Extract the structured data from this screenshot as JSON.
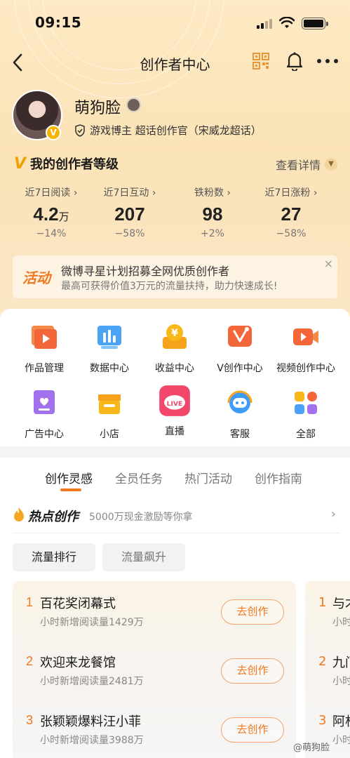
{
  "status_bar": {
    "time": "09:15"
  },
  "nav": {
    "title": "创作者中心"
  },
  "profile": {
    "username": "萌狗脸",
    "verification_badge": "V",
    "tags": "游戏博主 超话创作官（宋威龙超话）"
  },
  "creator_level": {
    "title": "我的创作者等级",
    "details_label": "查看详情",
    "stats": [
      {
        "label": "近7日阅读 ›",
        "value": "4.2",
        "unit": "万",
        "change": "−14%"
      },
      {
        "label": "近7日互动 ›",
        "value": "207",
        "unit": "",
        "change": "−58%"
      },
      {
        "label": "铁粉数 ›",
        "value": "98",
        "unit": "",
        "change": "+2%"
      },
      {
        "label": "近7日涨粉 ›",
        "value": "27",
        "unit": "",
        "change": "−58%"
      }
    ]
  },
  "banner": {
    "tag": "活动",
    "line1": "微博寻星计划招募全网优质创作者",
    "line2": "最高可获得价值3万元的流量扶持，助力快速成长!",
    "close": "×"
  },
  "grid": [
    {
      "label": "作品管理",
      "icon": "play-folder-icon"
    },
    {
      "label": "数据中心",
      "icon": "bar-chart-icon"
    },
    {
      "label": "收益中心",
      "icon": "yen-wallet-icon"
    },
    {
      "label": "V创作中心",
      "icon": "star-spark-icon"
    },
    {
      "label": "视频创作中心",
      "icon": "video-camera-icon"
    },
    {
      "label": "广告中心",
      "icon": "ad-book-icon"
    },
    {
      "label": "小店",
      "icon": "shop-icon"
    },
    {
      "label": "直播",
      "icon": "live-icon"
    },
    {
      "label": "客服",
      "icon": "headset-icon"
    },
    {
      "label": "全部",
      "icon": "all-apps-icon"
    }
  ],
  "tabs": [
    "创作灵感",
    "全员任务",
    "热门活动",
    "创作指南"
  ],
  "hot": {
    "title": "热点创作",
    "subtitle": "5000万现金激励等你拿"
  },
  "pills": [
    "流量排行",
    "流量飙升"
  ],
  "ranking": [
    {
      "rank": "1",
      "title": "百花奖闭幕式",
      "sub": "小时新增阅读量1429万",
      "button": "去创作"
    },
    {
      "rank": "2",
      "title": "欢迎来龙餐馆",
      "sub": "小时新增阅读量2481万",
      "button": "去创作"
    },
    {
      "rank": "3",
      "title": "张颖颖爆料汪小菲",
      "sub": "小时新增阅读量3988万",
      "button": "去创作"
    }
  ],
  "ranking_peek": [
    {
      "rank": "1",
      "title": "与才",
      "sub": "小时"
    },
    {
      "rank": "2",
      "title": "九门",
      "sub": "小时"
    },
    {
      "rank": "3",
      "title": "阿杜",
      "sub": "小时"
    }
  ],
  "watermark": "@萌狗脸",
  "colors": {
    "accent": "#f07820",
    "hero_bg": "#fbe3b7",
    "gold": "#f6b400"
  }
}
